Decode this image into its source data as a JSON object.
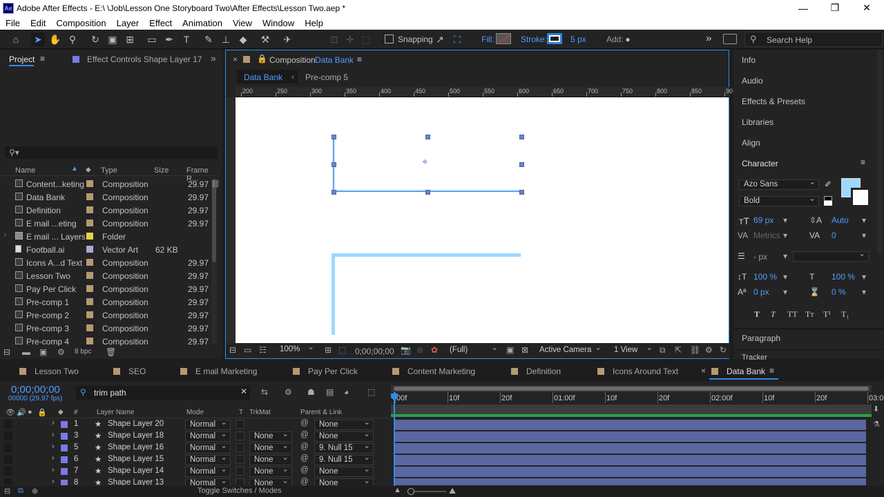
{
  "window": {
    "app_icon": "Ae",
    "title": "Adobe After Effects - E:\\ \\Job\\Lesson One Storyboard Two\\After Effects\\Lesson Two.aep *",
    "minimize": "—",
    "restore": "❐",
    "close": "✕"
  },
  "menu": [
    "File",
    "Edit",
    "Composition",
    "Layer",
    "Effect",
    "Animation",
    "View",
    "Window",
    "Help"
  ],
  "toolbar": {
    "snapping": "Snapping",
    "fill": "Fill:",
    "stroke": "Stroke:",
    "stroke_px": "5 px",
    "add": "Add:",
    "search_placeholder": "Search Help",
    "more": "»"
  },
  "project": {
    "tab": "Project",
    "effect_controls": "Effect Controls Shape Layer 17",
    "search_glyph": "⚲▾",
    "bpc": "8 bpc",
    "headers": {
      "name": "Name",
      "type": "Type",
      "size": "Size",
      "frame": "Frame R..."
    },
    "items": [
      {
        "name": "Content...keting",
        "type": "Composition",
        "size": "",
        "frame": "29.97",
        "label": "#b59a70"
      },
      {
        "name": "Data Bank",
        "type": "Composition",
        "size": "",
        "frame": "29.97",
        "label": "#b59a70"
      },
      {
        "name": "Definition",
        "type": "Composition",
        "size": "",
        "frame": "29.97",
        "label": "#b59a70"
      },
      {
        "name": "E mail ...eting",
        "type": "Composition",
        "size": "",
        "frame": "29.97",
        "label": "#b59a70"
      },
      {
        "name": "E mail ... Layers",
        "type": "Folder",
        "size": "",
        "frame": "",
        "label": "#e8d44a"
      },
      {
        "name": "Football.ai",
        "type": "Vector Art",
        "size": "62 KB",
        "frame": "",
        "label": "#a9a9d8"
      },
      {
        "name": "Icons A...d Text",
        "type": "Composition",
        "size": "",
        "frame": "29.97",
        "label": "#b59a70"
      },
      {
        "name": "Lesson Two",
        "type": "Composition",
        "size": "",
        "frame": "29.97",
        "label": "#b59a70"
      },
      {
        "name": "Pay Per Click",
        "type": "Composition",
        "size": "",
        "frame": "29.97",
        "label": "#b59a70"
      },
      {
        "name": "Pre-comp 1",
        "type": "Composition",
        "size": "",
        "frame": "29.97",
        "label": "#b59a70"
      },
      {
        "name": "Pre-comp 2",
        "type": "Composition",
        "size": "",
        "frame": "29.97",
        "label": "#b59a70"
      },
      {
        "name": "Pre-comp 3",
        "type": "Composition",
        "size": "",
        "frame": "29.97",
        "label": "#b59a70"
      },
      {
        "name": "Pre-comp 4",
        "type": "Composition",
        "size": "",
        "frame": "29.97",
        "label": "#b59a70"
      }
    ]
  },
  "composition": {
    "tab_prefix": "Composition",
    "tab_name": "Data Bank",
    "crumb1": "Data Bank",
    "crumb2": "Pre-comp 5",
    "ruler": [
      "200",
      "250",
      "300",
      "350",
      "400",
      "450",
      "500",
      "550",
      "600",
      "650",
      "700",
      "750",
      "800",
      "850",
      "90"
    ],
    "zoom": "100%",
    "timecode": "0;00;00;00",
    "resolution": "(Full)",
    "camera": "Active Camera",
    "views": "1 View"
  },
  "right": {
    "info": "Info",
    "audio": "Audio",
    "effects": "Effects & Presets",
    "libraries": "Libraries",
    "align": "Align",
    "character": "Character",
    "font": "Azo Sans",
    "style": "Bold",
    "size": "69 px",
    "leading": "Auto",
    "kerning": "Metrics",
    "tracking": "0",
    "stroke_w": "- px",
    "vscale": "100 %",
    "hscale": "100 %",
    "baseline": "0 px",
    "tsume": "0 %",
    "styles": [
      "T",
      "T",
      "TT",
      "Tт",
      "T¹",
      "T₁"
    ],
    "paragraph": "Paragraph",
    "tracker": "Tracker",
    "fill_color": "#9fd8ff"
  },
  "timeline": {
    "tabs": [
      {
        "name": "Lesson Two",
        "color": "#b59a70"
      },
      {
        "name": "SEO",
        "color": "#b59a70"
      },
      {
        "name": "E mail Marketing",
        "color": "#b59a70"
      },
      {
        "name": "Pay Per Click",
        "color": "#b59a70"
      },
      {
        "name": "Content Marketing",
        "color": "#b59a70"
      },
      {
        "name": "Definition",
        "color": "#b59a70"
      },
      {
        "name": "Icons Around Text",
        "color": "#b59a70"
      }
    ],
    "active_tab": "Data Bank",
    "timecode": "0;00;00;00",
    "fps": "00000 (29.97 fps)",
    "search": "trim path",
    "headers": {
      "layer_name": "Layer Name",
      "mode": "Mode",
      "t": "T",
      "trkmat": "TrkMat",
      "parent": "Parent & Link",
      "num": "#"
    },
    "ruler": [
      "00f",
      "10f",
      "20f",
      "01:00f",
      "10f",
      "20f",
      "02:00f",
      "10f",
      "20f",
      "03:0"
    ],
    "layers": [
      {
        "num": "1",
        "name": "Shape Layer 20",
        "mode": "Normal",
        "trkmat": "",
        "parent": "None"
      },
      {
        "num": "3",
        "name": "Shape Layer 18",
        "mode": "Normal",
        "trkmat": "None",
        "parent": "None"
      },
      {
        "num": "5",
        "name": "Shape Layer 16",
        "mode": "Normal",
        "trkmat": "None",
        "parent": "9. Null 15"
      },
      {
        "num": "6",
        "name": "Shape Layer 15",
        "mode": "Normal",
        "trkmat": "None",
        "parent": "9. Null 15"
      },
      {
        "num": "7",
        "name": "Shape Layer 14",
        "mode": "Normal",
        "trkmat": "None",
        "parent": "None"
      },
      {
        "num": "8",
        "name": "Shape Layer 13",
        "mode": "Normal",
        "trkmat": "None",
        "parent": "None"
      }
    ],
    "toggle": "Toggle Switches / Modes"
  }
}
